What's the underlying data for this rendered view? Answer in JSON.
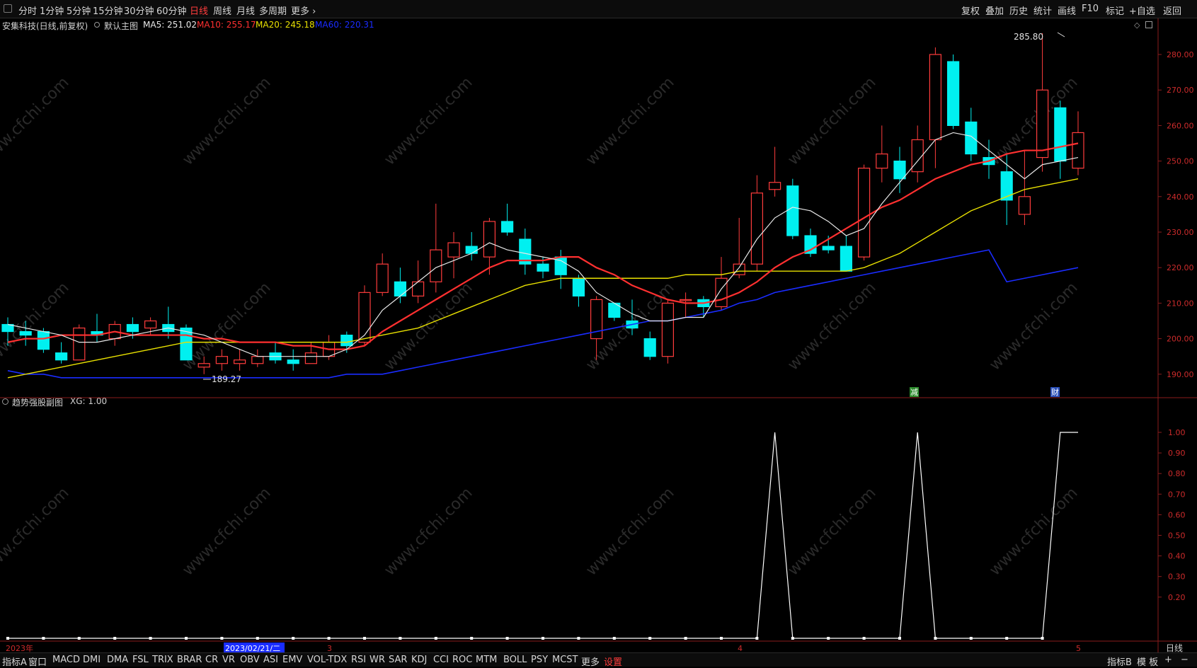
{
  "topbar": {
    "left_items": [
      "分时",
      "1分钟",
      "5分钟",
      "15分钟",
      "30分钟",
      "60分钟",
      "日线",
      "周线",
      "月线",
      "多周期",
      "更多 ›"
    ],
    "active": "日线",
    "right_items": [
      "复权",
      "叠加",
      "历史",
      "统计",
      "画线",
      "F10",
      "标记",
      "+自选",
      "返回"
    ]
  },
  "main_header": {
    "stock": "安集科技(日线,前复权)",
    "template": "默认主图",
    "ma5": "MA5: 251.02",
    "ma10": "MA10: 255.17",
    "ma20": "MA20: 245.18",
    "ma60": "MA60: 220.31",
    "colors": {
      "ma5": "#e8e8e8",
      "ma10": "#ff3030",
      "ma20": "#e8e000",
      "ma60": "#1a2cff"
    }
  },
  "sub_header": {
    "name": "趋势强股副图",
    "value": "XG: 1.00"
  },
  "annotations": {
    "high": "285.80",
    "low": "189.27",
    "event1": "减",
    "event2": "财"
  },
  "price_axis": {
    "labels": [
      "280.00",
      "270.00",
      "260.00",
      "250.00",
      "240.00",
      "230.00",
      "220.00",
      "210.00",
      "200.00",
      "190.00"
    ],
    "values": [
      280,
      270,
      260,
      250,
      240,
      230,
      220,
      210,
      200,
      190
    ]
  },
  "sub_axis": {
    "labels": [
      "1.00",
      "0.90",
      "0.80",
      "0.70",
      "0.60",
      "0.50",
      "0.40",
      "0.30",
      "0.20"
    ],
    "values": [
      1.0,
      0.9,
      0.8,
      0.7,
      0.6,
      0.5,
      0.4,
      0.3,
      0.2
    ]
  },
  "period_label": "日线",
  "date_labels": {
    "year": "2023年",
    "cursor": "2023/02/21/二",
    "m3": "3",
    "m4": "4",
    "m5": "5"
  },
  "watermark": "www.cfchi.com",
  "bottombar": {
    "items": [
      "指标A",
      "窗口",
      "MACD",
      "DMI",
      "DMA",
      "FSL",
      "TRIX",
      "BRAR",
      "CR",
      "VR",
      "OBV",
      "ASI",
      "EMV",
      "VOL-TDX",
      "RSI",
      "WR",
      "SAR",
      "KDJ",
      "CCI",
      "ROC",
      "MTM",
      "BOLL",
      "PSY",
      "MCST",
      "更多",
      "设置"
    ],
    "active": "设置",
    "right_items": [
      "指标B",
      "模 板",
      "+",
      "−"
    ]
  },
  "chart_data": {
    "type": "candlestick",
    "up_color": "#ff3c3c",
    "down_color": "#00f0f0",
    "ylim": [
      186,
      288
    ],
    "candles": [
      [
        204,
        202,
        206,
        198
      ],
      [
        202,
        201,
        205,
        198
      ],
      [
        202,
        197,
        203,
        196
      ],
      [
        196,
        194,
        199,
        193
      ],
      [
        194,
        203,
        204,
        194
      ],
      [
        202,
        201,
        207,
        199
      ],
      [
        200,
        204,
        205,
        198
      ],
      [
        204,
        202,
        206,
        200
      ],
      [
        203,
        205,
        206,
        201
      ],
      [
        204,
        202,
        209,
        200
      ],
      [
        203,
        194,
        204,
        194
      ],
      [
        192,
        193,
        195,
        190
      ],
      [
        193,
        195,
        197,
        191
      ],
      [
        193,
        194,
        197,
        191
      ],
      [
        193,
        195,
        197,
        192
      ],
      [
        196,
        194,
        199,
        193
      ],
      [
        194,
        193,
        197,
        191
      ],
      [
        193,
        196,
        199,
        193
      ],
      [
        195,
        199,
        201,
        194
      ],
      [
        201,
        198,
        202,
        196
      ],
      [
        199,
        213,
        215,
        198
      ],
      [
        213,
        221,
        224,
        212
      ],
      [
        216,
        212,
        220,
        210
      ],
      [
        212,
        216,
        222,
        210
      ],
      [
        216,
        225,
        238,
        213
      ],
      [
        223,
        227,
        230,
        217
      ],
      [
        226,
        224,
        230,
        222
      ],
      [
        223,
        233,
        234,
        218
      ],
      [
        233,
        230,
        238,
        229
      ],
      [
        228,
        221,
        231,
        218
      ],
      [
        221,
        219,
        223,
        217
      ],
      [
        223,
        218,
        225,
        214
      ],
      [
        217,
        212,
        218,
        209
      ],
      [
        200,
        211,
        212,
        194
      ],
      [
        210,
        206,
        210,
        205
      ],
      [
        205,
        203,
        211,
        201
      ],
      [
        200,
        195,
        202,
        194
      ],
      [
        195,
        210,
        211,
        193
      ],
      [
        211,
        211,
        213,
        206
      ],
      [
        211,
        209,
        212,
        206
      ],
      [
        209,
        217,
        223,
        208
      ],
      [
        218,
        221,
        234,
        217
      ],
      [
        221,
        241,
        246,
        219
      ],
      [
        242,
        244,
        254,
        240
      ],
      [
        243,
        229,
        245,
        228
      ],
      [
        229,
        224,
        231,
        223
      ],
      [
        226,
        225,
        229,
        224
      ],
      [
        226,
        219,
        229,
        219
      ],
      [
        223,
        248,
        249,
        222
      ],
      [
        248,
        252,
        260,
        244
      ],
      [
        250,
        245,
        254,
        241
      ],
      [
        247,
        256,
        260,
        244
      ],
      [
        256,
        280,
        282,
        248
      ],
      [
        278,
        260,
        280,
        259
      ],
      [
        261,
        252,
        265,
        250
      ],
      [
        251,
        249,
        256,
        245
      ],
      [
        247,
        239,
        252,
        232
      ],
      [
        235,
        240,
        253,
        232
      ],
      [
        251,
        270,
        286,
        247
      ],
      [
        265,
        250,
        267,
        245
      ],
      [
        248,
        258,
        264,
        246
      ]
    ],
    "ma5": [
      204,
      203,
      202,
      201,
      199,
      199,
      200,
      201,
      202,
      203,
      202,
      201,
      199,
      197,
      195,
      195,
      195,
      195,
      195,
      197,
      201,
      208,
      212,
      216,
      220,
      222,
      224,
      227,
      225,
      224,
      223,
      222,
      219,
      213,
      210,
      207,
      205,
      205,
      206,
      206,
      214,
      220,
      228,
      234,
      237,
      236,
      233,
      229,
      231,
      238,
      244,
      250,
      256,
      258,
      257,
      253,
      249,
      245,
      249,
      250,
      251
    ],
    "ma10": [
      199,
      200,
      200,
      201,
      201,
      201,
      202,
      201,
      201,
      201,
      201,
      200,
      200,
      199,
      199,
      199,
      198,
      198,
      197,
      197,
      198,
      202,
      205,
      208,
      211,
      214,
      217,
      220,
      222,
      222,
      222,
      223,
      223,
      220,
      218,
      215,
      213,
      211,
      210,
      210,
      211,
      213,
      216,
      220,
      223,
      225,
      228,
      231,
      234,
      237,
      239,
      242,
      245,
      247,
      249,
      250,
      252,
      253,
      253,
      254,
      255
    ],
    "ma20": [
      189,
      190,
      191,
      192,
      193,
      194,
      195,
      196,
      197,
      198,
      199,
      199,
      199,
      199,
      199,
      199,
      199,
      199,
      199,
      199,
      200,
      201,
      202,
      203,
      205,
      207,
      209,
      211,
      213,
      215,
      216,
      217,
      217,
      217,
      217,
      217,
      217,
      217,
      218,
      218,
      218,
      219,
      219,
      219,
      219,
      219,
      219,
      219,
      220,
      222,
      224,
      227,
      230,
      233,
      236,
      238,
      240,
      242,
      243,
      244,
      245
    ],
    "ma60": [
      191,
      190,
      190,
      189,
      189,
      189,
      189,
      189,
      189,
      189,
      189,
      189,
      189,
      189,
      189,
      189,
      189,
      189,
      189,
      190,
      190,
      190,
      191,
      192,
      193,
      194,
      195,
      196,
      197,
      198,
      199,
      200,
      201,
      202,
      203,
      204,
      205,
      205,
      206,
      207,
      208,
      210,
      211,
      213,
      214,
      215,
      216,
      217,
      218,
      219,
      220,
      221,
      222,
      223,
      224,
      225,
      216,
      217,
      218,
      219,
      220
    ],
    "xg": [
      0,
      0,
      0,
      0,
      0,
      0,
      0,
      0,
      0,
      0,
      0,
      0,
      0,
      0,
      0,
      0,
      0,
      0,
      0,
      0,
      0,
      0,
      0,
      0,
      0,
      0,
      0,
      0,
      0,
      0,
      0,
      0,
      0,
      0,
      0,
      0,
      0,
      0,
      0,
      0,
      0,
      0,
      0,
      1,
      0,
      0,
      0,
      0,
      0,
      0,
      0,
      1,
      0,
      0,
      0,
      0,
      0,
      0,
      0,
      1,
      1
    ]
  }
}
